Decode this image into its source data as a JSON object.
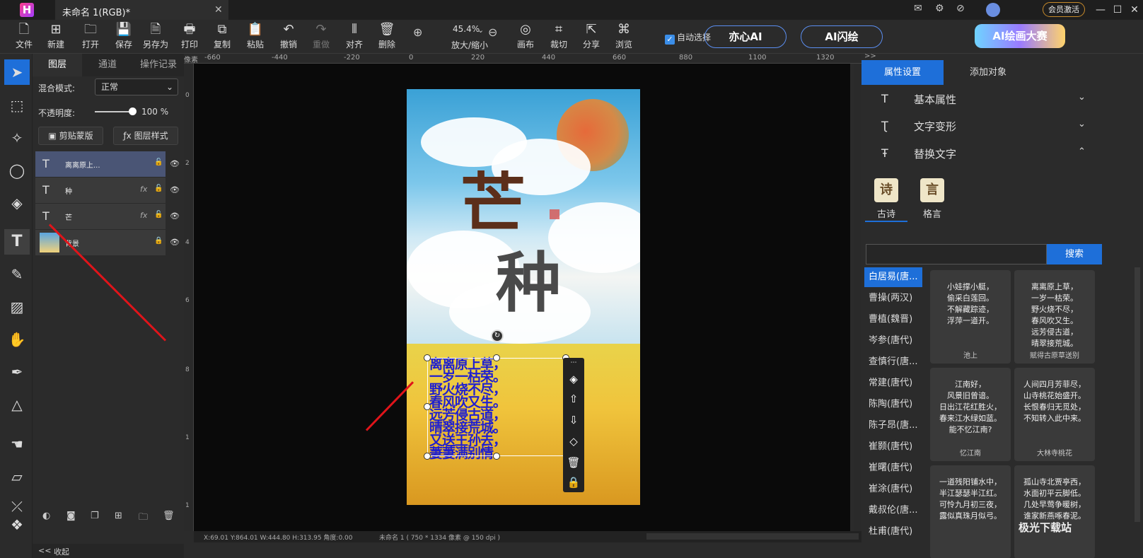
{
  "app": {
    "logo": "H",
    "document_tab": "未命名 1(RGB)*",
    "close": "✕",
    "vip_label": "会员激活"
  },
  "toolbar": {
    "tools": [
      {
        "label": "文件",
        "icon": "🗋"
      },
      {
        "label": "新建",
        "icon": "⊞"
      },
      {
        "label": "打开",
        "icon": "🗀"
      },
      {
        "label": "保存",
        "icon": "💾"
      },
      {
        "label": "另存为",
        "icon": "🗎"
      },
      {
        "label": "打印",
        "icon": "🖶"
      },
      {
        "label": "复制",
        "icon": "⧉"
      },
      {
        "label": "粘贴",
        "icon": "📋"
      },
      {
        "label": "撤销",
        "icon": "↶"
      },
      {
        "label": "重做",
        "icon": "↷"
      },
      {
        "label": "对齐",
        "icon": "⫴"
      },
      {
        "label": "删除",
        "icon": "🗑"
      }
    ],
    "zoom_value": "45.4%",
    "zoom_label": "放大/缩小",
    "right_tools": [
      {
        "label": "画布",
        "icon": "◎"
      },
      {
        "label": "裁切",
        "icon": "⌗"
      },
      {
        "label": "分享",
        "icon": "⇱"
      },
      {
        "label": "浏览",
        "icon": "⌘"
      }
    ],
    "auto_select": "自动选择",
    "ai_buttons": [
      "亦心AI",
      "AI闪绘"
    ],
    "promo": "AI绘画大赛"
  },
  "layer_panel": {
    "tabs": [
      "图层",
      "通道",
      "操作记录"
    ],
    "blend_label": "混合模式:",
    "blend_value": "正常",
    "opacity_label": "不透明度:",
    "opacity_value": "100 %",
    "opacity": 1.0,
    "clip_btn": "剪贴蒙版",
    "style_btn": "图层样式",
    "layers": [
      {
        "name": "离离原上...",
        "icon": "T"
      },
      {
        "name": "种",
        "icon": "T",
        "fx": "fx"
      },
      {
        "name": "芒",
        "icon": "T",
        "fx": "fx"
      },
      {
        "name": "背景",
        "icon": "img"
      }
    ],
    "collapse": "收起"
  },
  "ruler": {
    "unit": "像素",
    "ticks": [
      "-660",
      "-440",
      "-220",
      "0",
      "220",
      "440",
      "660",
      "880",
      "1100",
      "1320"
    ],
    "left_ticks": [
      "0",
      "2",
      "4",
      "6",
      "8",
      "1",
      "1"
    ]
  },
  "canvas": {
    "title_a": "芒",
    "title_b": "种",
    "poem": [
      "离离原上草，",
      "一岁一枯荣。",
      "野火烧不尽，",
      "春风吹又生。",
      "远芳侵古道，",
      "晴翠接荒城。",
      "又送王孙去，",
      "萋萋满别情。"
    ]
  },
  "status": {
    "coords": "X:69.01 Y:864.01 W:444.80 H:313.95 角度:0.00",
    "doc": "未命名 1 ( 750 * 1334 像素 @ 150 dpi )"
  },
  "right_panel": {
    "tabs": [
      "属性设置",
      "添加对象"
    ],
    "sections": [
      {
        "label": "基本属性",
        "chevron": "⌄"
      },
      {
        "label": "文字变形",
        "chevron": "⌄"
      },
      {
        "label": "替换文字",
        "chevron": "⌃"
      }
    ],
    "categories": [
      {
        "label": "古诗",
        "glyph": "诗"
      },
      {
        "label": "格言",
        "glyph": "言"
      }
    ],
    "search_btn": "搜索",
    "poets": [
      "白居易(唐...",
      "曹操(两汉)",
      "曹植(魏晋)",
      "岑参(唐代)",
      "查慎行(唐...",
      "常建(唐代)",
      "陈陶(唐代)",
      "陈子昂(唐...",
      "崔颢(唐代)",
      "崔曙(唐代)",
      "崔涂(唐代)",
      "戴叔伦(唐...",
      "杜甫(唐代)"
    ],
    "cards": [
      {
        "body": "小娃撑小艇，\n偷采白莲回。\n不解藏踪迹，\n浮萍一道开。",
        "title": "池上"
      },
      {
        "body": "离离原上草，\n一岁一枯荣。\n野火烧不尽，\n春风吹又生。\n远芳侵古道，\n晴翠接荒城。",
        "title": "赋得古原草送别"
      },
      {
        "body": "江南好，\n风景旧曾谙。\n日出江花红胜火，\n春来江水绿如蓝。\n能不忆江南?",
        "title": "忆江南"
      },
      {
        "body": "人间四月芳菲尽，\n山寺桃花始盛开。\n长恨春归无觅处，\n不知转入此中来。",
        "title": "大林寺桃花"
      },
      {
        "body": "一道残阳铺水中，\n半江瑟瑟半江红。\n可怜九月初三夜，\n露似真珠月似弓。",
        "title": ""
      },
      {
        "body": "孤山寺北贾亭西，\n水面初平云脚低。\n几处早莺争暖树，\n谁家新燕啄春泥。",
        "title": ""
      }
    ]
  },
  "watermark": "极光下载站"
}
